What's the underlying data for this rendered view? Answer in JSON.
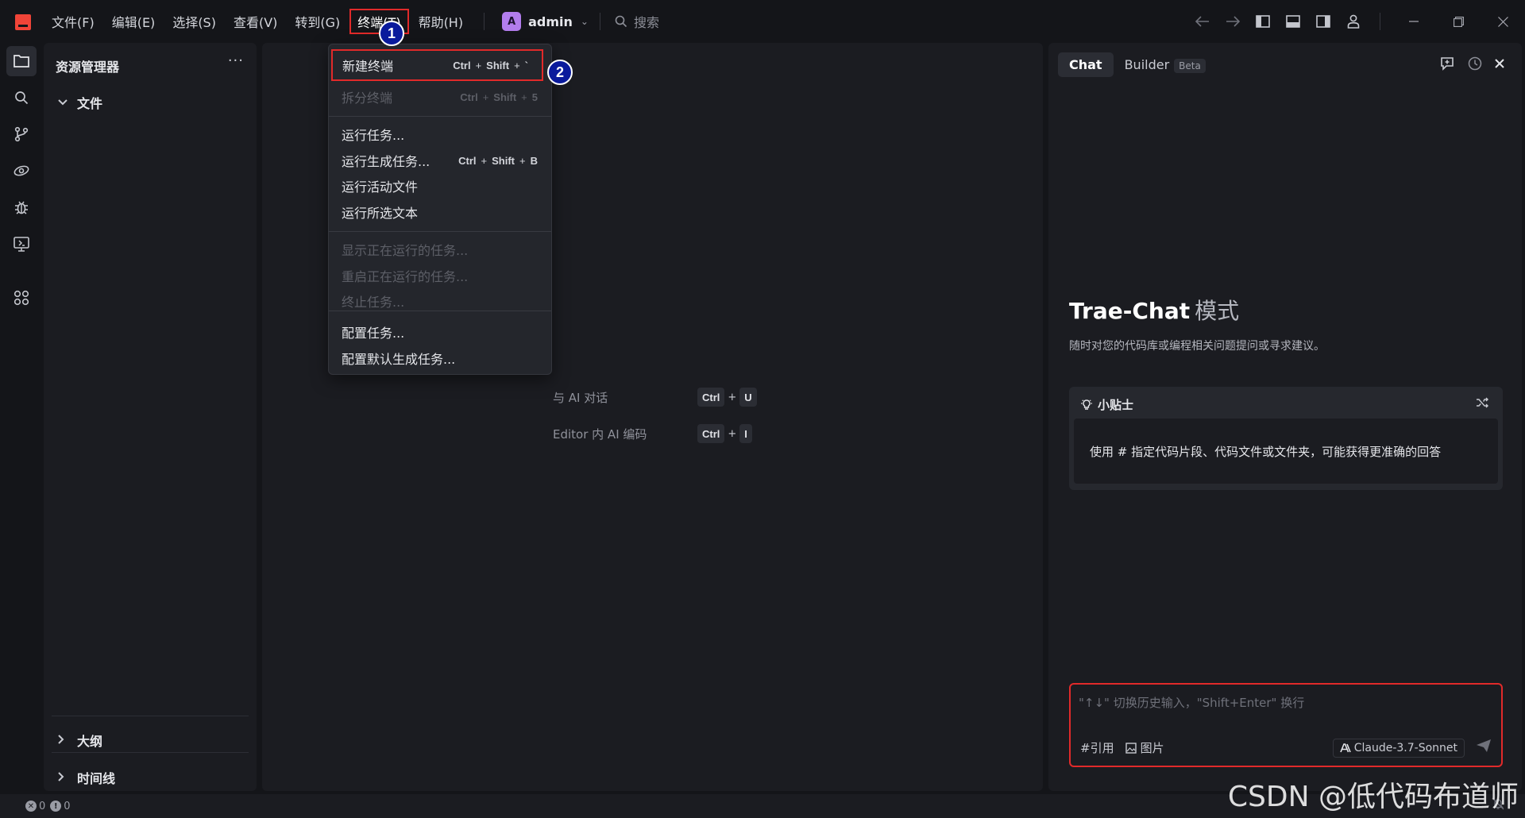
{
  "menubar": {
    "items": [
      "文件(F)",
      "编辑(E)",
      "选择(S)",
      "查看(V)",
      "转到(G)",
      "终端(T)",
      "帮助(H)"
    ],
    "active_index": 5,
    "user": {
      "initial": "A",
      "name": "admin"
    },
    "search_placeholder": "搜索"
  },
  "explorer": {
    "title": "资源管理器",
    "more": "···",
    "folder": "文件",
    "outline": "大纲",
    "timeline": "时间线"
  },
  "terminal_menu": {
    "items": [
      {
        "label": "新建终端",
        "shortcut": [
          "Ctrl",
          "Shift",
          "`"
        ],
        "disabled": false,
        "highlighted": true
      },
      {
        "label": "拆分终端",
        "shortcut": [
          "Ctrl",
          "Shift",
          "5"
        ],
        "disabled": true
      },
      {
        "label": "运行任务...",
        "disabled": false
      },
      {
        "label": "运行生成任务...",
        "shortcut": [
          "Ctrl",
          "Shift",
          "B"
        ],
        "disabled": false
      },
      {
        "label": "运行活动文件",
        "disabled": false
      },
      {
        "label": "运行所选文本",
        "disabled": false
      },
      {
        "label": "显示正在运行的任务...",
        "disabled": true
      },
      {
        "label": "重启正在运行的任务...",
        "disabled": true
      },
      {
        "label": "终止任务...",
        "disabled": true
      },
      {
        "label": "配置任务...",
        "disabled": false
      },
      {
        "label": "配置默认生成任务...",
        "disabled": false
      }
    ],
    "plus": "+"
  },
  "callouts": [
    "1",
    "2"
  ],
  "editor_hints": [
    {
      "label": "与 AI 对话",
      "keys": [
        "Ctrl",
        "U"
      ]
    },
    {
      "label": "Editor 内 AI 编码",
      "keys": [
        "Ctrl",
        "I"
      ]
    }
  ],
  "chat": {
    "tab_chat": "Chat",
    "tab_builder": "Builder",
    "beta": "Beta",
    "heading": "Trae-Chat",
    "heading_mode": "模式",
    "subtitle": "随时对您的代码库或编程相关问题提问或寻求建议。",
    "tip_title": "小贴士",
    "tip_text": "使用 # 指定代码片段、代码文件或文件夹，可能获得更准确的回答",
    "input_placeholder": "\"↑↓\" 切换历史输入，\"Shift+Enter\" 换行",
    "ref_label": "#引用",
    "image_label": "图片",
    "model": "Claude-3.7-Sonnet"
  },
  "status": {
    "errors": "0",
    "warnings": "0"
  },
  "watermark": "CSDN @低代码布道师",
  "colors": {
    "highlight_red": "#e12a2a",
    "callout_blue": "#0a1a9c",
    "logo_red": "#f04438",
    "avatar_purple": "#b27ded"
  }
}
